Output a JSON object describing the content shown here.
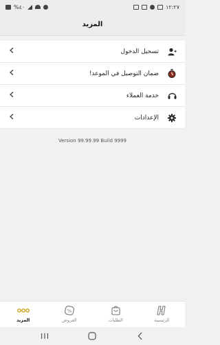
{
  "status_bar": {
    "time": "١٢:٢٧",
    "battery": "%٤٠"
  },
  "header": {
    "title": "المزيد"
  },
  "menu": {
    "items": [
      {
        "label": "تسجيل الدخول",
        "icon": "add-user-icon"
      },
      {
        "label": "ضمان التوصيل في الموعد!",
        "icon": "stopwatch-icon"
      },
      {
        "label": "خدمة العملاء",
        "icon": "headset-icon"
      },
      {
        "label": "الإعدادات",
        "icon": "gear-icon"
      }
    ]
  },
  "version_text": "Version 99.99.99 Build 9999",
  "bottom_nav": {
    "items": [
      {
        "label": "المزيد",
        "icon": "more-dots-icon",
        "active": true
      },
      {
        "label": "العروض",
        "icon": "offers-icon",
        "active": false
      },
      {
        "label": "الطلبات",
        "icon": "orders-bag-icon",
        "active": false
      },
      {
        "label": "الرئيسية",
        "icon": "home-logo-icon",
        "active": false
      }
    ]
  },
  "colors": {
    "accent": "#c8a012",
    "background": "#f1f1f1",
    "surface": "#ffffff",
    "icon_dark": "#2b2b2b",
    "stopwatch_red": "#8b2a1a"
  }
}
